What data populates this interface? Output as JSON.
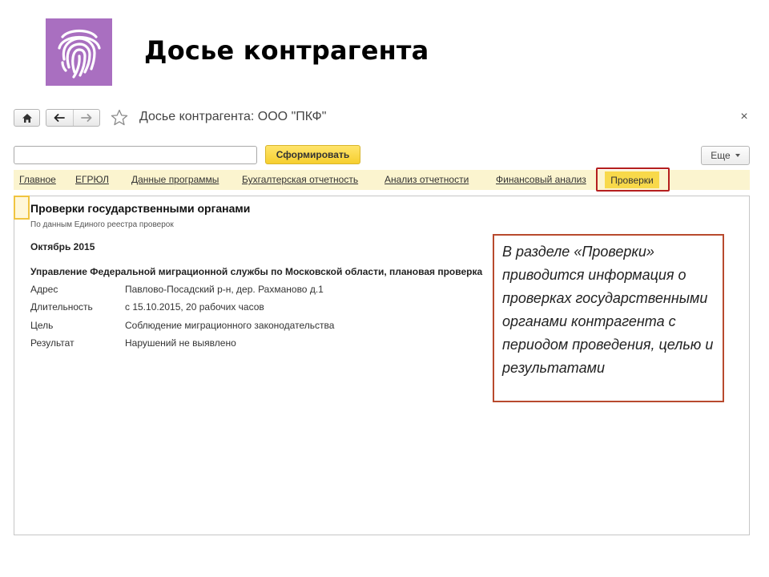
{
  "slide": {
    "title": "Досье контрагента"
  },
  "logo": {
    "icon": "fingerprint-icon",
    "color": "#a96fc0"
  },
  "window": {
    "title": "Досье контрагента: ООО \"ПКФ\"",
    "close_glyph": "×"
  },
  "toolbar": {
    "search_value": "",
    "generate_label": "Сформировать",
    "more_label": "Еще"
  },
  "tabs": [
    {
      "label": "Главное",
      "active": false
    },
    {
      "label": "ЕГРЮЛ",
      "active": false
    },
    {
      "label": "Данные программы",
      "active": false
    },
    {
      "label": "Бухгалтерская отчетность",
      "active": false
    },
    {
      "label": "Анализ отчетности",
      "active": false
    },
    {
      "label": "Финансовый анализ",
      "active": false
    },
    {
      "label": "Проверки",
      "active": true
    }
  ],
  "report": {
    "title": "Проверки государственными органами",
    "subtitle": "По данным Единого реестра проверок",
    "period": "Октябрь 2015",
    "agency": "Управление Федеральной миграционной службы по Московской области, плановая проверка",
    "rows": [
      {
        "label": "Адрес",
        "value": "Павлово-Посадский р-н, дер. Рахманово д.1"
      },
      {
        "label": "Длительность",
        "value": "с 15.10.2015, 20 рабочих часов"
      },
      {
        "label": "Цель",
        "value": "Соблюдение миграционного законодательства"
      },
      {
        "label": "Результат",
        "value": "Нарушений не выявлено"
      }
    ]
  },
  "callout": {
    "text": "В разделе «Проверки» приводится информация о проверках государственными органами контрагента с периодом проведения, целью и результатами"
  },
  "colors": {
    "accent_yellow": "#f8d94a",
    "tab_bar": "#fbf4cf",
    "highlight_red": "#b51f1f",
    "callout_border": "#b84a2e"
  }
}
